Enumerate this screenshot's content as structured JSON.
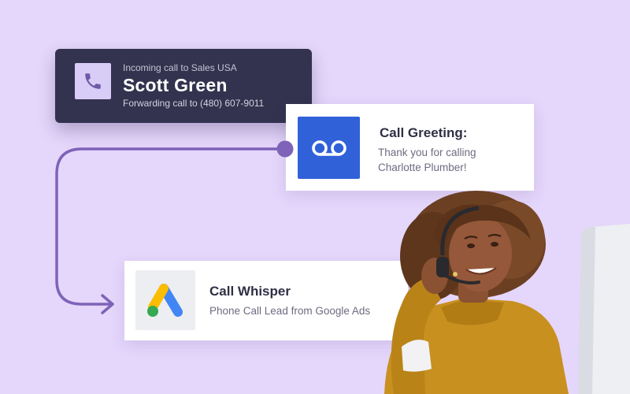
{
  "incoming_call": {
    "kicker": "Incoming call to Sales USA",
    "caller_name": "Scott Green",
    "forwarding": "Forwarding call to (480) 607-9011",
    "icon": "phone-icon"
  },
  "call_greeting": {
    "title": "Call Greeting:",
    "message_line1": "Thank you for calling",
    "message_line2": "Charlotte Plumber!",
    "icon": "voicemail-icon"
  },
  "call_whisper": {
    "title": "Call Whisper",
    "subtitle": "Phone Call Lead from Google Ads",
    "icon": "google-ads-icon"
  },
  "colors": {
    "background": "#e5d6fb",
    "dark_card": "#33334f",
    "flow_line": "#7e63b8",
    "voicemail_blue": "#3061d9",
    "ads_blue": "#4285f4",
    "ads_yellow": "#fbbc04",
    "ads_green": "#34a853",
    "sweater_mustard": "#c8901f"
  }
}
